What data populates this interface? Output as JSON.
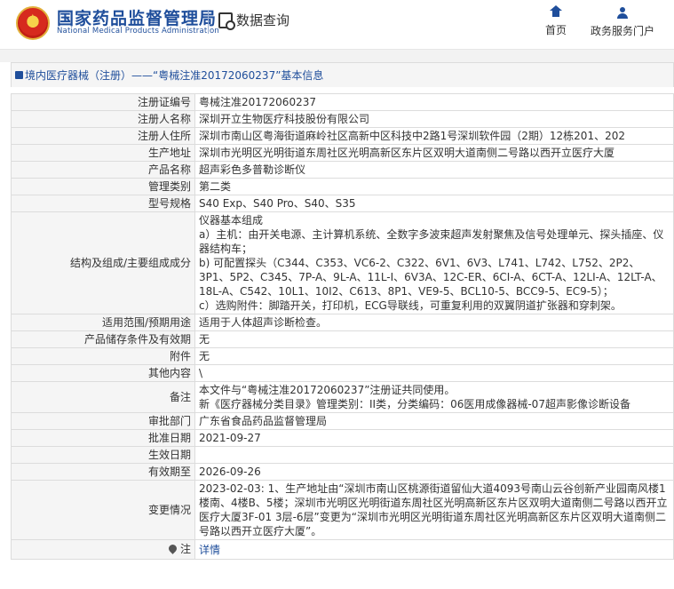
{
  "header": {
    "brand_cn": "国家药品监督管理局",
    "brand_en": "National Medical Products Administration",
    "module_title": "数据查询",
    "nav": [
      {
        "label": "首页",
        "icon": "home-icon"
      },
      {
        "label": "政务服务门户",
        "icon": "user-icon"
      }
    ]
  },
  "breadcrumb": {
    "text": "境内医疗器械（注册）——“粤械注准20172060237”基本信息"
  },
  "rows": [
    {
      "label": "注册证编号",
      "value": "粤械注准20172060237"
    },
    {
      "label": "注册人名称",
      "value": "深圳开立生物医疗科技股份有限公司"
    },
    {
      "label": "注册人住所",
      "value": "深圳市南山区粤海街道麻岭社区高新中区科技中2路1号深圳软件园（2期）12栋201、202"
    },
    {
      "label": "生产地址",
      "value": "深圳市光明区光明街道东周社区光明高新区东片区双明大道南侧二号路以西开立医疗大厦"
    },
    {
      "label": "产品名称",
      "value": "超声彩色多普勒诊断仪"
    },
    {
      "label": "管理类别",
      "value": "第二类"
    },
    {
      "label": "型号规格",
      "value": "S40 Exp、S40 Pro、S40、S35"
    },
    {
      "label": "结构及组成/主要组成成分",
      "value_lines": [
        "仪器基本组成",
        "a）主机：由开关电源、主计算机系统、全数字多波束超声发射聚焦及信号处理单元、探头插座、仪器结构车；",
        "b) 可配置探头（C344、C353、VC6-2、C322、6V1、6V3、L741、L742、L752、2P2、3P1、5P2、C345、7P-A、9L-A、11L-I、6V3A、12C-ER、6CI-A、6CT-A、12LI-A、12LT-A、18L-A、C542、10L1、10I2、C613、8P1、VE9-5、BCL10-5、BCC9-5、EC9-5）；",
        "c）选购附件：脚踏开关，打印机，ECG导联线，可重复利用的双翼阴道扩张器和穿刺架。"
      ]
    },
    {
      "label": "适用范围/预期用途",
      "value": "适用于人体超声诊断检查。"
    },
    {
      "label": "产品储存条件及有效期",
      "value": "无"
    },
    {
      "label": "附件",
      "value": "无"
    },
    {
      "label": "其他内容",
      "value": "\\"
    },
    {
      "label": "备注",
      "value_lines": [
        "本文件与“粤械注准20172060237”注册证共同使用。",
        "新《医疗器械分类目录》管理类别：II类，分类编码：06医用成像器械-07超声影像诊断设备"
      ]
    },
    {
      "label": "审批部门",
      "value": "广东省食品药品监督管理局"
    },
    {
      "label": "批准日期",
      "value": "2021-09-27"
    },
    {
      "label": "生效日期",
      "value": ""
    },
    {
      "label": "有效期至",
      "value": "2026-09-26"
    },
    {
      "label": "变更情况",
      "value": "2023-02-03: 1、生产地址由“深圳市南山区桃源街道留仙大道4093号南山云谷创新产业园南风楼1楼南、4楼B、5楼；深圳市光明区光明街道东周社区光明高新区东片区双明大道南侧二号路以西开立医疗大厦3F-01 3层-6层”变更为“深圳市光明区光明街道东周社区光明高新区东片区双明大道南侧二号路以西开立医疗大厦”。"
    },
    {
      "label": "注",
      "value": "详情"
    }
  ],
  "colors": {
    "brand_blue": "#1f4e9b",
    "label_bg": "#f5f5f5",
    "border": "#dcdcdc"
  }
}
